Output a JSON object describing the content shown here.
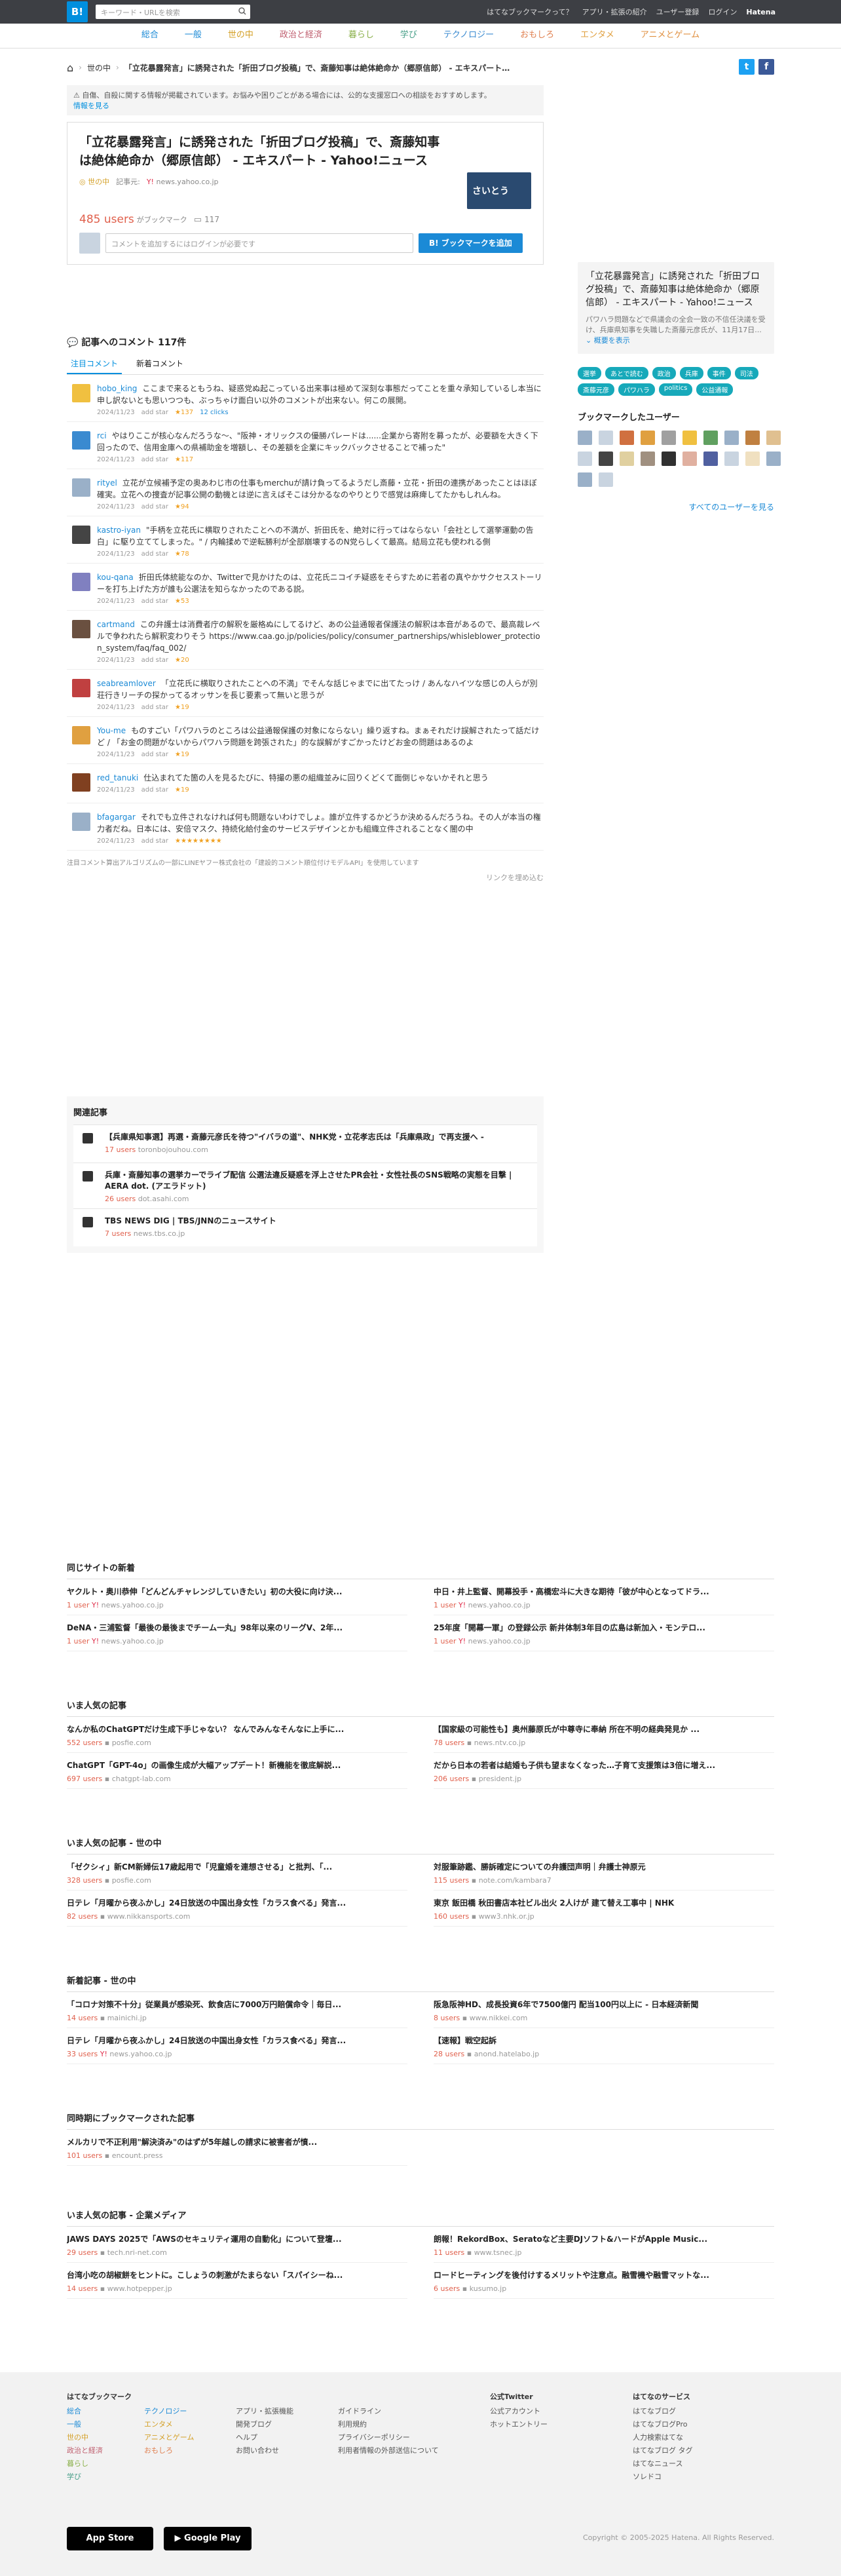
{
  "topbar": {
    "logo": "B!",
    "search_placeholder": "キーワード・URLを検索",
    "links": [
      "はてなブックマークって？",
      "アプリ・拡張の紹介",
      "ユーザー登録",
      "ログイン",
      "Hatena"
    ]
  },
  "categories": [
    "総合",
    "一般",
    "世の中",
    "政治と経済",
    "暮らし",
    "学び",
    "テクノロジー",
    "おもしろ",
    "エンタメ",
    "アニメとゲーム"
  ],
  "breadcrumb": {
    "home": "⌂",
    "section": "世の中",
    "title": "「立花暴露発言」に誘発された「折田ブログ投稿」で、斎藤知事は絶体絶命か（郷原信郎） - エキスパート…"
  },
  "notice": {
    "text": "自傷、自殺に関する情報が掲載されています。お悩みや困りごとがある場合には、公的な支援窓口への相談をおすすめします。",
    "link": "情報を見る"
  },
  "entry": {
    "title": "「立花暴露発言」に誘発された「折田ブログ投稿」で、斎藤知事は絶体絶命か（郷原信郎） - エキスパート - Yahoo!ニュース",
    "thumb_text": "さいとう",
    "category": "世の中",
    "source_label": "記事元:",
    "source": "news.yahoo.co.jp",
    "users": "485 users",
    "bookmark_label": "がブックマーク",
    "comment_count": "117",
    "comment_placeholder": "コメントを追加するにはログインが必要です",
    "add_button": "ブックマークを追加"
  },
  "comments_section": {
    "title": "記事へのコメント 117件",
    "tab_popular": "注目コメント",
    "tab_new": "新着コメント"
  },
  "comments": [
    {
      "user": "hobo_king",
      "text": "ここまで来るともうね、疑惑党ぬ起こっている出来事は極めて深刻な事態だってことを重々承知しているし本当に申し訳ないとも思いつつも、ぶっちゃけ面白い以外のコメントが出来ない。何この展開。",
      "date": "2024/11/23",
      "stars": "★137",
      "clicks": "12 clicks",
      "color": "#f0c040"
    },
    {
      "user": "rci",
      "text": "やはりここが核心なんだろうな〜、\"阪神・オリックスの優勝パレードは......企業から寄附を募ったが、必要額を大きく下回ったので、信用金庫への県補助金を増額し、その差額を企業にキックバックさせることで補った\"",
      "date": "2024/11/23",
      "stars": "★117",
      "clicks": "",
      "color": "#3a8ad0"
    },
    {
      "user": "rityel",
      "text": "立花が立候補予定の奥あわじ市の仕事もmerchuが請け負ってるようだし斎藤・立花・折田の連携があったことはほぼ確実。立花への捜査が記事公開の動機とは逆に言えばそこは分かるなのやりとりで感覚は麻痺してたかもしれんね。",
      "date": "2024/11/23",
      "stars": "★94",
      "clicks": "",
      "color": "#9ab0c8"
    },
    {
      "user": "kastro-iyan",
      "text": "\"手柄を立花氏に横取りされたことへの不満が、折田氏を、絶対に行ってはならない「会社として選挙運動の告白」に駆り立ててしまった。\" / 内輪揉めで逆転勝利が全部崩壊するのN党らしくて最高。結局立花も使われる側",
      "date": "2024/11/23",
      "stars": "★78",
      "clicks": "",
      "color": "#444"
    },
    {
      "user": "kou-qana",
      "text": "折田氏体統能なのか、Twitterで見かけたのは、立花氏ニコイチ疑惑をそらすために若者の真やかサクセスストーリーを打ち上げた方が誰も公選法を知らなかったのである説。",
      "date": "2024/11/23",
      "stars": "★53",
      "clicks": "",
      "color": "#8080c0"
    },
    {
      "user": "cartmand",
      "text": "この弁護士は消費者庁の解釈を厳格ぬにしてるけど、あの公益通報者保護法の解釈は本音があるので、最高裁レベルで争われたら解釈変わりそう https://www.caa.go.jp/policies/policy/consumer_partnerships/whisleblower_protection_system/faq/faq_002/",
      "date": "2024/11/23",
      "stars": "★20",
      "clicks": "",
      "color": "#6a5040"
    },
    {
      "user": "seabreamlover",
      "text": "「立花氏に横取りされたことへの不満」でそんな話じゃまでに出てたっけ / あんなハイツな感じの人らが別荘行きリーチの探かってるオッサンを長じ要素って無いと思うが",
      "date": "2024/11/23",
      "stars": "★19",
      "clicks": "",
      "color": "#c04040"
    },
    {
      "user": "You-me",
      "text": "ものすごい「パワハラのところは公益通報保護の対象にならない」繰り返すね。まぁそれだけ誤解されたって話だけど / 「お金の問題がないからパワハラ問題を跨張された」的な誤解がすごかったけどお金の問題はあるのよ",
      "date": "2024/11/23",
      "stars": "★19",
      "clicks": "",
      "color": "#e0a040"
    },
    {
      "user": "red_tanuki",
      "text": "仕込まれてた箇の人を見るたびに、特撮の悪の組織並みに回りくどくて面倒じゃないかそれと思う",
      "date": "2024/11/23",
      "stars": "★19",
      "clicks": "",
      "color": "#804020"
    },
    {
      "user": "bfagargar",
      "text": "それでも立件されなければ何も問題ないわけでしょ。誰が立件するかどうか決めるんだろうね。その人が本当の権力者だね。日本には、安倍マスク、持続化給付金のサービスデザインとかも組織立件されることなく闇の中",
      "date": "2024/11/23",
      "stars": "★★★★★★★★",
      "clicks": "",
      "color": "#9ab0c8"
    }
  ],
  "comment_note": "注目コメント算出アルゴリズムの一部にLINEヤフー株式会社の「建設的コメント順位付けモデルAPI」を使用しています",
  "see_link": "リンクを埋め込む",
  "related": {
    "title": "関連記事",
    "items": [
      {
        "title": "【兵庫県知事選】再選・斎藤元彦氏を待つ\"イバラの道\"、NHK党・立花孝志氏は「兵庫県政」で再支援へ -",
        "users": "17 users",
        "source": "toronbojouhou.com"
      },
      {
        "title": "兵庫・斎藤知事の選挙カーでライブ配信 公選法違反疑惑を浮上させたPR会社・女性社長のSNS戦略の実態を目撃 | AERA dot. (アエラドット)",
        "users": "26 users",
        "source": "dot.asahi.com"
      },
      {
        "title": "TBS NEWS DIG | TBS/JNNのニュースサイト",
        "users": "7 users",
        "source": "news.tbs.co.jp"
      }
    ]
  },
  "sidebar": {
    "title": "「立花暴露発言」に誘発された「折田ブログ投稿」で、斎藤知事は絶体絶命か（郷原信郎） - エキスパート - Yahoo!ニュース",
    "desc": "パワハラ問題などで県議会の全会一致の不信任決議を受け、兵庫県知事を失職した斎藤元彦氏が、11月17日...",
    "more": "概要を表示",
    "tags": [
      "選挙",
      "あとで読む",
      "政治",
      "兵庫",
      "事件",
      "司法",
      "斎藤元彦",
      "パワハラ",
      "politics",
      "公益通報"
    ],
    "users_head": "ブックマークしたユーザー",
    "all_users": "すべてのユーザーを見る"
  },
  "sections": [
    {
      "title": "同じサイトの新着",
      "items": [
        {
          "t": "ヤクルト・奥川恭伸「どんどんチャレンジしていきたい」初の大役に向け決...",
          "u": "1 user",
          "s": "news.yahoo.co.jp"
        },
        {
          "t": "中日・井上監督、開幕投手・高橋宏斗に大きな期待「彼が中心となってドラ...",
          "u": "1 user",
          "s": "news.yahoo.co.jp"
        },
        {
          "t": "DeNA・三浦監督「最後の最後までチーム一丸」98年以来のリーグV、2年...",
          "u": "1 user",
          "s": "news.yahoo.co.jp"
        },
        {
          "t": "25年度「開幕一軍」の登録公示 新井体制3年目の広島は新加入・モンテロ...",
          "u": "1 user",
          "s": "news.yahoo.co.jp"
        }
      ]
    },
    {
      "title": "いま人気の記事",
      "items": [
        {
          "t": "なんか私のChatGPTだけ生成下手じゃない？ なんでみんなそんなに上手に...",
          "u": "552 users",
          "s": "posfie.com"
        },
        {
          "t": "【国家級の可能性も】奥州藤原氏が中尊寺に奉納 所在不明の経典発見か ...",
          "u": "78 users",
          "s": "news.ntv.co.jp"
        },
        {
          "t": "ChatGPT「GPT-4o」の画像生成が大幅アップデート！新機能を徹底解説...",
          "u": "697 users",
          "s": "chatgpt-lab.com"
        },
        {
          "t": "だから日本の若者は結婚も子供も望まなくなった…子育て支援策は3倍に増え...",
          "u": "206 users",
          "s": "president.jp"
        }
      ]
    },
    {
      "title": "いま人気の記事 - 世の中",
      "items": [
        {
          "t": "「ゼクシィ」新CM新婦伝17歳起用で「児童婚を連想させる」と批判、「...",
          "u": "328 users",
          "s": "posfie.com"
        },
        {
          "t": "対服筆跡鑑、勝訴確定についての弁護団声明｜弁護士神原元",
          "u": "115 users",
          "s": "note.com/kambara7"
        },
        {
          "t": "日テレ「月曜から夜ふかし」24日放送の中国出身女性「カラス食べる」発言...",
          "u": "82 users",
          "s": "www.nikkansports.com"
        },
        {
          "t": "東京 飯田橋 秋田書店本社ビル出火 2人けが 建て替え工事中 | NHK",
          "u": "160 users",
          "s": "www3.nhk.or.jp"
        }
      ]
    },
    {
      "title": "新着記事 - 世の中",
      "items": [
        {
          "t": "「コロナ対策不十分」従業員が感染死、飲食店に7000万円賠償命令｜毎日...",
          "u": "14 users",
          "s": "mainichi.jp"
        },
        {
          "t": "阪急阪神HD、成長投資6年で7500億円 配当100円以上に - 日本経済新聞",
          "u": "8 users",
          "s": "www.nikkei.com"
        },
        {
          "t": "日テレ「月曜から夜ふかし」24日放送の中国出身女性「カラス食べる」発言...",
          "u": "33 users",
          "s": "news.yahoo.co.jp"
        },
        {
          "t": "【速報】戦空起訴",
          "u": "28 users",
          "s": "anond.hatelabo.jp"
        }
      ]
    },
    {
      "title": "同時期にブックマークされた記事",
      "items": [
        {
          "t": "メルカリで不正利用\"解決済み\"のはずが5年越しの請求に被害者が憤...",
          "u": "101 users",
          "s": "encount.press"
        }
      ]
    },
    {
      "title": "いま人気の記事 - 企業メディア",
      "items": [
        {
          "t": "JAWS DAYS 2025で「AWSのセキュリティ運用の自動化」について登壇...",
          "u": "29 users",
          "s": "tech.nri-net.com"
        },
        {
          "t": "朗報！RekordBox、Seratoなど主要DJソフト&ハードがApple Music...",
          "u": "11 users",
          "s": "www.tsnec.jp"
        },
        {
          "t": "台湾小吃の胡椒餅をヒントに。こしょうの刺激がたまらない「スパイシーね...",
          "u": "14 users",
          "s": "www.hotpepper.jp"
        },
        {
          "t": "ロードヒーティングを後付けするメリットや注意点。融雪機や融雪マットな...",
          "u": "6 users",
          "s": "kusumo.jp"
        }
      ]
    }
  ],
  "footer": {
    "col1_head": "はてなブックマーク",
    "col1": [
      "総合",
      "一般",
      "世の中",
      "政治と経済",
      "暮らし",
      "学び"
    ],
    "col2": [
      "テクノロジー",
      "エンタメ",
      "アニメとゲーム",
      "おもしろ"
    ],
    "col3": [
      "アプリ・拡張機能",
      "開発ブログ",
      "ヘルプ",
      "お問い合わせ"
    ],
    "col4": [
      "ガイドライン",
      "利用規約",
      "プライバシーポリシー",
      "利用者情報の外部送信について"
    ],
    "col5_head": "公式Twitter",
    "col5": [
      "公式アカウント",
      "ホットエントリー"
    ],
    "col6_head": "はてなのサービス",
    "col6": [
      "はてなブログ",
      "はてなブログPro",
      "人力検索はてな",
      "はてなブログ タグ",
      "はてなニュース",
      "ソレドコ"
    ],
    "app_store": "App Store",
    "google_play": "Google Play",
    "copyright": "Copyright © 2005-2025 Hatena. All Rights Reserved."
  },
  "colors": {
    "brand": "#008fde",
    "users": "#e0604c",
    "tag": "#17a9ba"
  }
}
